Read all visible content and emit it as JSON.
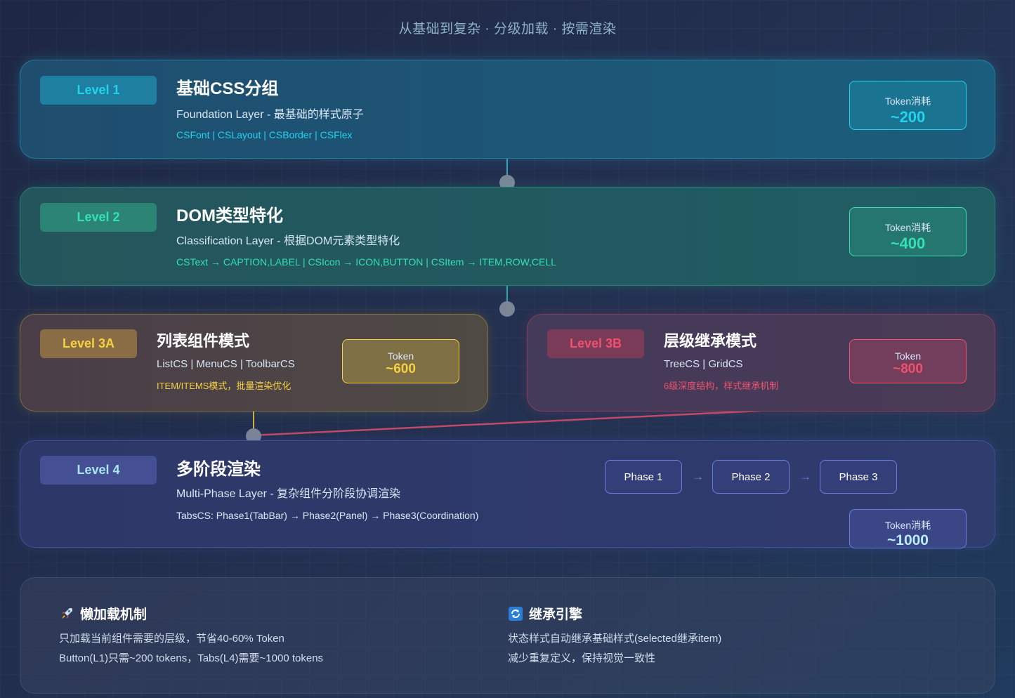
{
  "subtitle": "从基础到复杂 · 分级加载 · 按需渲染",
  "levels": [
    {
      "badge": "Level 1",
      "title": "基础CSS分组",
      "desc": "Foundation Layer - 最基础的样式原子",
      "items": "CSFont | CSLayout | CSBorder | CSFlex",
      "token_label": "Token消耗",
      "token_value": "~200",
      "accent": "#22d3ee"
    },
    {
      "badge": "Level 2",
      "title": "DOM类型特化",
      "desc": "Classification Layer - 根据DOM元素类型特化",
      "items": "CSText → CAPTION,LABEL | CSIcon → ICON,BUTTON | CSItem → ITEM,ROW,CELL",
      "token_label": "Token消耗",
      "token_value": "~400",
      "accent": "#34e0b4"
    },
    {
      "badge": "Level 3A",
      "title": "列表组件模式",
      "desc": "ListCS | MenuCS | ToolbarCS",
      "items": "ITEM/ITEMS模式，批量渲染优化",
      "token_label": "Token",
      "token_value": "~600",
      "accent": "#f5d142"
    },
    {
      "badge": "Level 3B",
      "title": "层级继承模式",
      "desc": "TreeCS | GridCS",
      "items": "6级深度结构，样式继承机制",
      "token_label": "Token",
      "token_value": "~800",
      "accent": "#f0506e"
    },
    {
      "badge": "Level 4",
      "title": "多阶段渲染",
      "desc": "Multi-Phase Layer - 复杂组件分阶段协调渲染",
      "items": "TabsCS: Phase1(TabBar) → Phase2(Panel) → Phase3(Coordination)",
      "token_label": "Token消耗",
      "token_value": "~1000",
      "accent": "#8ea2ff"
    }
  ],
  "phases": [
    "Phase 1",
    "Phase 2",
    "Phase 3"
  ],
  "phase_arrow": "→",
  "features": [
    {
      "icon": "rocket-icon",
      "title": "懒加载机制",
      "lines": [
        "只加载当前组件需要的层级，节省40-60% Token",
        "Button(L1)只需~200 tokens，Tabs(L4)需要~1000 tokens"
      ]
    },
    {
      "icon": "refresh-icon",
      "title": "继承引擎",
      "lines": [
        "状态样式自动继承基础样式(selected继承item)",
        "减少重复定义，保持视觉一致性"
      ]
    }
  ]
}
